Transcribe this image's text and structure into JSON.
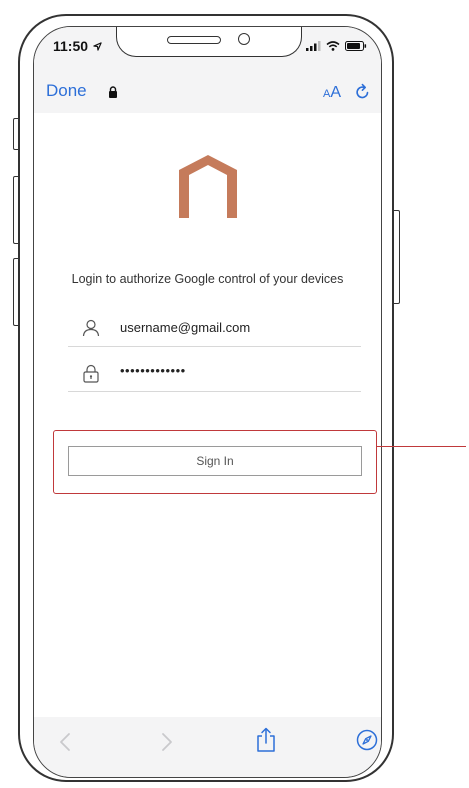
{
  "status_bar": {
    "time": "11:50",
    "location_icon": "location-arrow-icon",
    "signal_icon": "cellular-signal-icon",
    "wifi_icon": "wifi-icon",
    "battery_icon": "battery-icon"
  },
  "browser": {
    "done_label": "Done",
    "lock_icon": "lock-icon",
    "text_size_small": "A",
    "text_size_large": "A",
    "reload_icon": "reload-icon"
  },
  "page": {
    "logo_icon": "house-outline-logo",
    "prompt": "Login to authorize Google control of your devices",
    "username_icon": "user-icon",
    "username_value": "username@gmail.com",
    "password_icon": "padlock-icon",
    "password_value": "•••••••••••••",
    "sign_in_label": "Sign In"
  },
  "toolbar": {
    "back_icon": "chevron-left-icon",
    "forward_icon": "chevron-right-icon",
    "share_icon": "share-icon",
    "browser_icon": "compass-icon"
  },
  "colors": {
    "accent_blue": "#2d6fd8",
    "logo_copper": "#c57b5b",
    "highlight_red": "#c0393b"
  }
}
